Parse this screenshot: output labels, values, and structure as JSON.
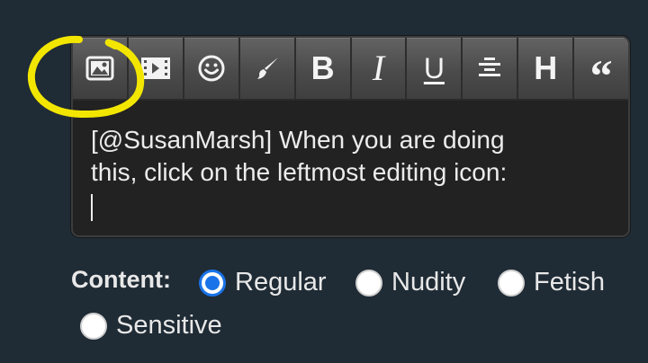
{
  "editor": {
    "toolbar": [
      {
        "name": "image-icon",
        "label": ""
      },
      {
        "name": "video-icon",
        "label": ""
      },
      {
        "name": "emoji-icon",
        "label": ""
      },
      {
        "name": "brush-icon",
        "label": ""
      },
      {
        "name": "bold-icon",
        "label": "B"
      },
      {
        "name": "italic-icon",
        "label": "I"
      },
      {
        "name": "underline-icon",
        "label": "U"
      },
      {
        "name": "align-center-icon",
        "label": ""
      },
      {
        "name": "heading-icon",
        "label": "H"
      },
      {
        "name": "quote-icon",
        "label": "“"
      }
    ],
    "text_line_1": "[@SusanMarsh] When you are doing",
    "text_line_2": "this, click on the leftmost editing icon:"
  },
  "annotation": {
    "highlight_color": "#f2e600"
  },
  "content": {
    "label": "Content:",
    "options": [
      {
        "label": "Regular",
        "checked": true
      },
      {
        "label": "Nudity",
        "checked": false
      },
      {
        "label": "Fetish",
        "checked": false
      },
      {
        "label": "Sensitive",
        "checked": false
      }
    ],
    "accent": "#1a73e8"
  }
}
